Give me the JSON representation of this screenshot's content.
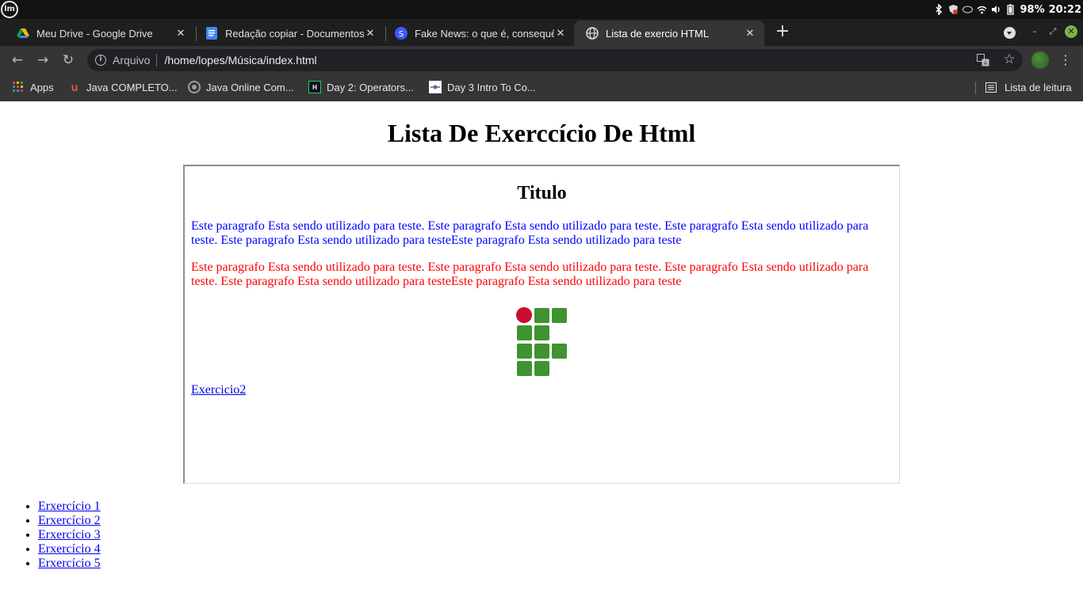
{
  "tray": {
    "battery": "98%",
    "clock": "20:22"
  },
  "tabs": [
    {
      "title": "Meu Drive - Google Drive",
      "icon": "google-drive-icon"
    },
    {
      "title": "Redação copiar - Documentos",
      "icon": "google-docs-icon"
    },
    {
      "title": "Fake News: o que é, consequências",
      "icon": "site-icon"
    },
    {
      "title": "Lista de exercio HTML",
      "icon": "globe-icon",
      "active": true
    }
  ],
  "toolbar": {
    "site_label": "Arquivo",
    "url": "/home/lopes/Música/index.html"
  },
  "bookmarks": {
    "items": [
      {
        "label": "Apps",
        "icon": "apps-grid-icon"
      },
      {
        "label": "Java COMPLETO...",
        "icon": "udemy-icon"
      },
      {
        "label": "Java Online Com...",
        "icon": "site-icon"
      },
      {
        "label": "Day 2: Operators...",
        "icon": "hackerrank-icon"
      },
      {
        "label": "Day 3 Intro To Co...",
        "icon": "site-icon"
      }
    ],
    "reading_list": "Lista de leitura"
  },
  "page": {
    "title": "Lista De Exerccício De Html",
    "box_title": "Titulo",
    "para_blue": "Este paragrafo Esta sendo utilizado para teste. Este paragrafo Esta sendo utilizado para teste. Este paragrafo Esta sendo utilizado para teste. Este paragrafo Esta sendo utilizado para testeEste paragrafo Esta sendo utilizado para teste",
    "para_red": "Este paragrafo Esta sendo utilizado para teste. Este paragrafo Esta sendo utilizado para teste. Este paragrafo Esta sendo utilizado para teste. Este paragrafo Esta sendo utilizado para testeEste paragrafo Esta sendo utilizado para teste",
    "link": "Exercicio2",
    "list": [
      "Erxercício 1",
      "Erxercício 2",
      "Erxercício 3",
      "Erxercício 4",
      "Erxercício 5"
    ]
  },
  "colors": {
    "para_blue": "#0000ff",
    "para_red": "#ff0000",
    "link": "#0000ee",
    "logo_green": "#3f9330",
    "logo_red": "#c8102e"
  }
}
